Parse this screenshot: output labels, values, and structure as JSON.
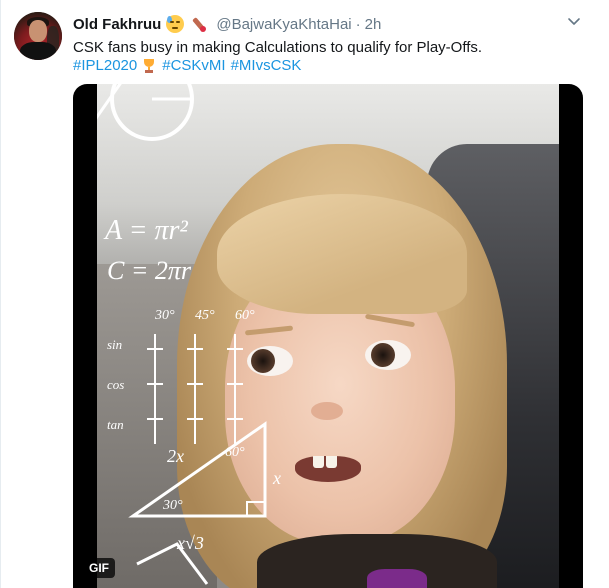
{
  "tweet": {
    "display_name": "Old Fakhruu",
    "name_emojis": [
      "downcast-sweat-face-icon",
      "cricket-bat-icon"
    ],
    "handle": "@BajwaKyaKhtaHai",
    "separator": "·",
    "time": "2h",
    "text": "CSK fans busy in making Calculations to qualify for Play-Offs.",
    "hashtags": [
      "#IPL2020",
      "#CSKvMI",
      "#MIvsCSK"
    ],
    "hashtag_emoji": "trophy-icon",
    "media_badge": "GIF",
    "more_menu_icon": "chevron-down-icon"
  },
  "math_overlay": {
    "formulas": [
      "A = πr²",
      "C = 2πr",
      "30°",
      "45°",
      "60°",
      "sin",
      "cos",
      "tan",
      "2x",
      "60°",
      "x",
      "30°",
      "x√3"
    ]
  },
  "colors": {
    "name": "#14171a",
    "secondary": "#657786",
    "link": "#1b95e0",
    "border": "#e6ecf0"
  }
}
